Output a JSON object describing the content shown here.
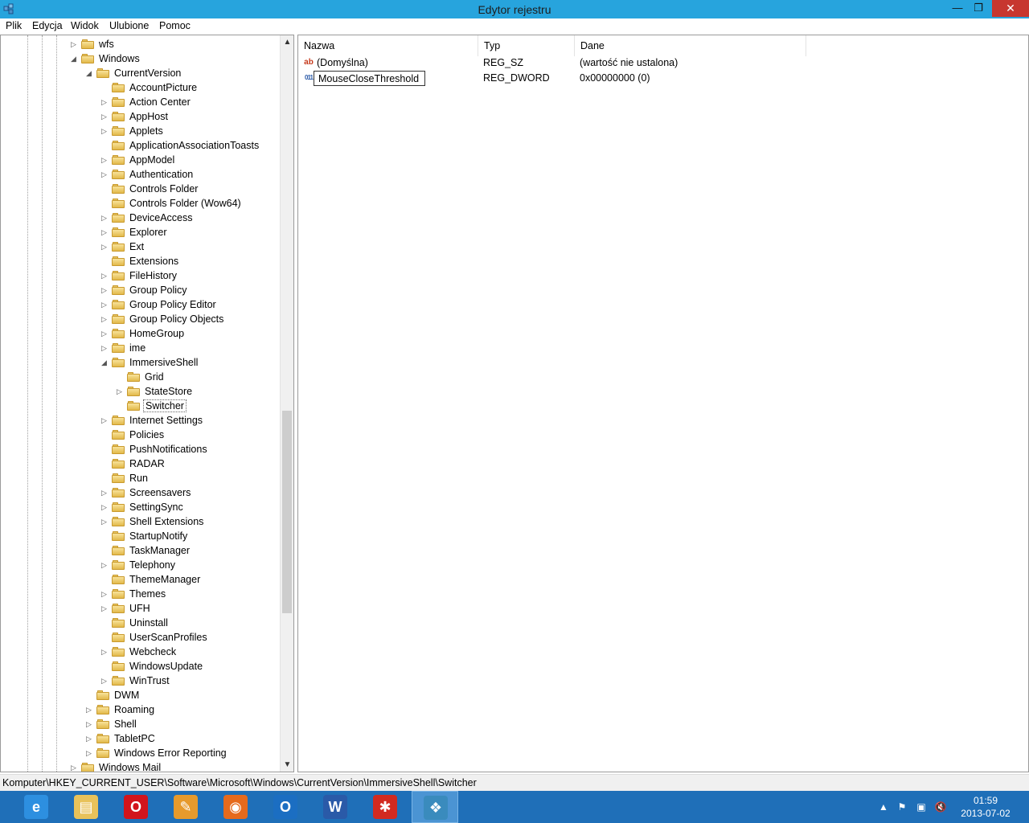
{
  "window": {
    "title": "Edytor rejestru",
    "minimize_glyph": "—",
    "maximize_glyph": "❐",
    "close_glyph": "✕",
    "accent_color": "#27a4dd",
    "close_color": "#c7372f"
  },
  "menu": [
    "Plik",
    "Edycja",
    "Widok",
    "Ulubione",
    "Pomoc"
  ],
  "tree": {
    "items": [
      {
        "label": "wfs",
        "level": 0,
        "expander": "closed"
      },
      {
        "label": "Windows",
        "level": 0,
        "expander": "open"
      },
      {
        "label": "CurrentVersion",
        "level": 1,
        "expander": "open"
      },
      {
        "label": "AccountPicture",
        "level": 2,
        "expander": "none"
      },
      {
        "label": "Action Center",
        "level": 2,
        "expander": "closed"
      },
      {
        "label": "AppHost",
        "level": 2,
        "expander": "closed"
      },
      {
        "label": "Applets",
        "level": 2,
        "expander": "closed"
      },
      {
        "label": "ApplicationAssociationToasts",
        "level": 2,
        "expander": "none"
      },
      {
        "label": "AppModel",
        "level": 2,
        "expander": "closed"
      },
      {
        "label": "Authentication",
        "level": 2,
        "expander": "closed"
      },
      {
        "label": "Controls Folder",
        "level": 2,
        "expander": "none"
      },
      {
        "label": "Controls Folder (Wow64)",
        "level": 2,
        "expander": "none"
      },
      {
        "label": "DeviceAccess",
        "level": 2,
        "expander": "closed"
      },
      {
        "label": "Explorer",
        "level": 2,
        "expander": "closed"
      },
      {
        "label": "Ext",
        "level": 2,
        "expander": "closed"
      },
      {
        "label": "Extensions",
        "level": 2,
        "expander": "none"
      },
      {
        "label": "FileHistory",
        "level": 2,
        "expander": "closed"
      },
      {
        "label": "Group Policy",
        "level": 2,
        "expander": "closed"
      },
      {
        "label": "Group Policy Editor",
        "level": 2,
        "expander": "closed"
      },
      {
        "label": "Group Policy Objects",
        "level": 2,
        "expander": "closed"
      },
      {
        "label": "HomeGroup",
        "level": 2,
        "expander": "closed"
      },
      {
        "label": "ime",
        "level": 2,
        "expander": "closed"
      },
      {
        "label": "ImmersiveShell",
        "level": 2,
        "expander": "open"
      },
      {
        "label": "Grid",
        "level": 3,
        "expander": "none"
      },
      {
        "label": "StateStore",
        "level": 3,
        "expander": "closed"
      },
      {
        "label": "Switcher",
        "level": 3,
        "expander": "none",
        "selected": true
      },
      {
        "label": "Internet Settings",
        "level": 2,
        "expander": "closed"
      },
      {
        "label": "Policies",
        "level": 2,
        "expander": "none"
      },
      {
        "label": "PushNotifications",
        "level": 2,
        "expander": "none"
      },
      {
        "label": "RADAR",
        "level": 2,
        "expander": "none"
      },
      {
        "label": "Run",
        "level": 2,
        "expander": "none"
      },
      {
        "label": "Screensavers",
        "level": 2,
        "expander": "closed"
      },
      {
        "label": "SettingSync",
        "level": 2,
        "expander": "closed"
      },
      {
        "label": "Shell Extensions",
        "level": 2,
        "expander": "closed"
      },
      {
        "label": "StartupNotify",
        "level": 2,
        "expander": "none"
      },
      {
        "label": "TaskManager",
        "level": 2,
        "expander": "none"
      },
      {
        "label": "Telephony",
        "level": 2,
        "expander": "closed"
      },
      {
        "label": "ThemeManager",
        "level": 2,
        "expander": "none"
      },
      {
        "label": "Themes",
        "level": 2,
        "expander": "closed"
      },
      {
        "label": "UFH",
        "level": 2,
        "expander": "closed"
      },
      {
        "label": "Uninstall",
        "level": 2,
        "expander": "none"
      },
      {
        "label": "UserScanProfiles",
        "level": 2,
        "expander": "none"
      },
      {
        "label": "Webcheck",
        "level": 2,
        "expander": "closed"
      },
      {
        "label": "WindowsUpdate",
        "level": 2,
        "expander": "none"
      },
      {
        "label": "WinTrust",
        "level": 2,
        "expander": "closed"
      },
      {
        "label": "DWM",
        "level": 1,
        "expander": "none"
      },
      {
        "label": "Roaming",
        "level": 1,
        "expander": "closed"
      },
      {
        "label": "Shell",
        "level": 1,
        "expander": "closed"
      },
      {
        "label": "TabletPC",
        "level": 1,
        "expander": "closed"
      },
      {
        "label": "Windows Error Reporting",
        "level": 1,
        "expander": "closed"
      },
      {
        "label": "Windows Mail",
        "level": 0,
        "expander": "closed"
      }
    ]
  },
  "list": {
    "columns": [
      "Nazwa",
      "Typ",
      "Dane"
    ],
    "rows": [
      {
        "name": "(Domyślna)",
        "type": "REG_SZ",
        "data": "(wartość nie ustalona)",
        "icon": "string-value-icon",
        "glyph": "ab"
      },
      {
        "name": "MouseCloseThreshold",
        "type": "REG_DWORD",
        "data": "0x00000000 (0)",
        "icon": "binary-value-icon",
        "glyph": "011",
        "editing": true
      }
    ]
  },
  "statusbar": {
    "path": "Komputer\\HKEY_CURRENT_USER\\Software\\Microsoft\\Windows\\CurrentVersion\\ImmersiveShell\\Switcher"
  },
  "taskbar": {
    "apps": [
      {
        "name": "internet-explorer",
        "glyph": "e",
        "color": "#2d8fe0"
      },
      {
        "name": "file-explorer",
        "glyph": "▤",
        "color": "#e8c25a"
      },
      {
        "name": "opera",
        "glyph": "O",
        "color": "#d2141c"
      },
      {
        "name": "paint",
        "glyph": "✎",
        "color": "#e79a2c"
      },
      {
        "name": "firefox",
        "glyph": "◉",
        "color": "#e66a1c"
      },
      {
        "name": "outlook",
        "glyph": "O",
        "color": "#1b6ec2"
      },
      {
        "name": "word",
        "glyph": "W",
        "color": "#2a5aa8"
      },
      {
        "name": "acrobat",
        "glyph": "✱",
        "color": "#d22a20"
      },
      {
        "name": "registry-editor",
        "glyph": "❖",
        "color": "#3a8bbd",
        "active": true
      }
    ],
    "tray": [
      "▲",
      "⚑",
      "▣",
      "🔇"
    ],
    "clock_time": "01:59",
    "clock_date": "2013-07-02"
  }
}
